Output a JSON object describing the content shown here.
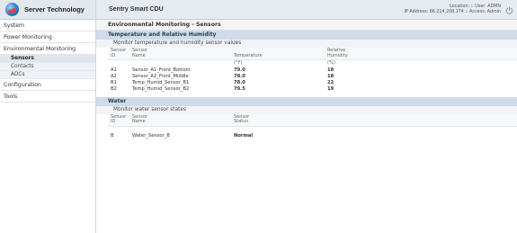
{
  "brand": {
    "name": "Server Technology"
  },
  "header": {
    "title": "Sentry Smart CDU",
    "location_line": "Location: :: User: ADMN",
    "ip_line": "IP Address: 66.214.208.174 :: Access: Admin"
  },
  "sidebar": {
    "items": [
      {
        "label": "System"
      },
      {
        "label": "Power Monitoring"
      },
      {
        "label": "Environmental Monitoring"
      },
      {
        "label": "Configuration"
      },
      {
        "label": "Tools"
      }
    ],
    "env_sub": [
      {
        "label": "Sensors"
      },
      {
        "label": "Contacts"
      },
      {
        "label": "ADCs"
      }
    ]
  },
  "main": {
    "page_title": "Environmental Monitoring - Sensors",
    "temp_section": {
      "title": "Temperature and Relative Humidity",
      "description": "Monitor temperature and humidity sensor values",
      "headers": {
        "id_1": "Sensor",
        "id_2": "ID",
        "name_1": "Sensor",
        "name_2": "Name",
        "temp": "Temperature",
        "hum_1": "Relative",
        "hum_2": "Humidity"
      },
      "units": {
        "temp": "(°F)",
        "hum": "(%)"
      },
      "rows": [
        {
          "id": "A1",
          "name": "Sensor_A1_Front_Bottom",
          "temp": "79.0",
          "hum": "18"
        },
        {
          "id": "A2",
          "name": "Sensor_A2_Front_Middle",
          "temp": "78.0",
          "hum": "18"
        },
        {
          "id": "B1",
          "name": "Temp_Humid_Sensor_B1",
          "temp": "78.0",
          "hum": "22"
        },
        {
          "id": "B2",
          "name": "Temp_Humid_Sensor_B2",
          "temp": "79.5",
          "hum": "19"
        }
      ]
    },
    "water_section": {
      "title": "Water",
      "description": "Monitor water sensor states",
      "headers": {
        "id_1": "Sensor",
        "id_2": "ID",
        "name_1": "Sensor",
        "name_2": "Name",
        "status_1": "Sensor",
        "status_2": "Status"
      },
      "rows": [
        {
          "id": "B",
          "name": "Water_Sensor_B",
          "status": "Normal"
        }
      ]
    }
  },
  "icons": {
    "logout": "power-icon",
    "logo": "globe-logo-icon"
  },
  "colors": {
    "section_header_bg": "#cfdbe6",
    "header_bg": "#e6ebf0",
    "sidebar_active_bg": "#dde5ed"
  }
}
